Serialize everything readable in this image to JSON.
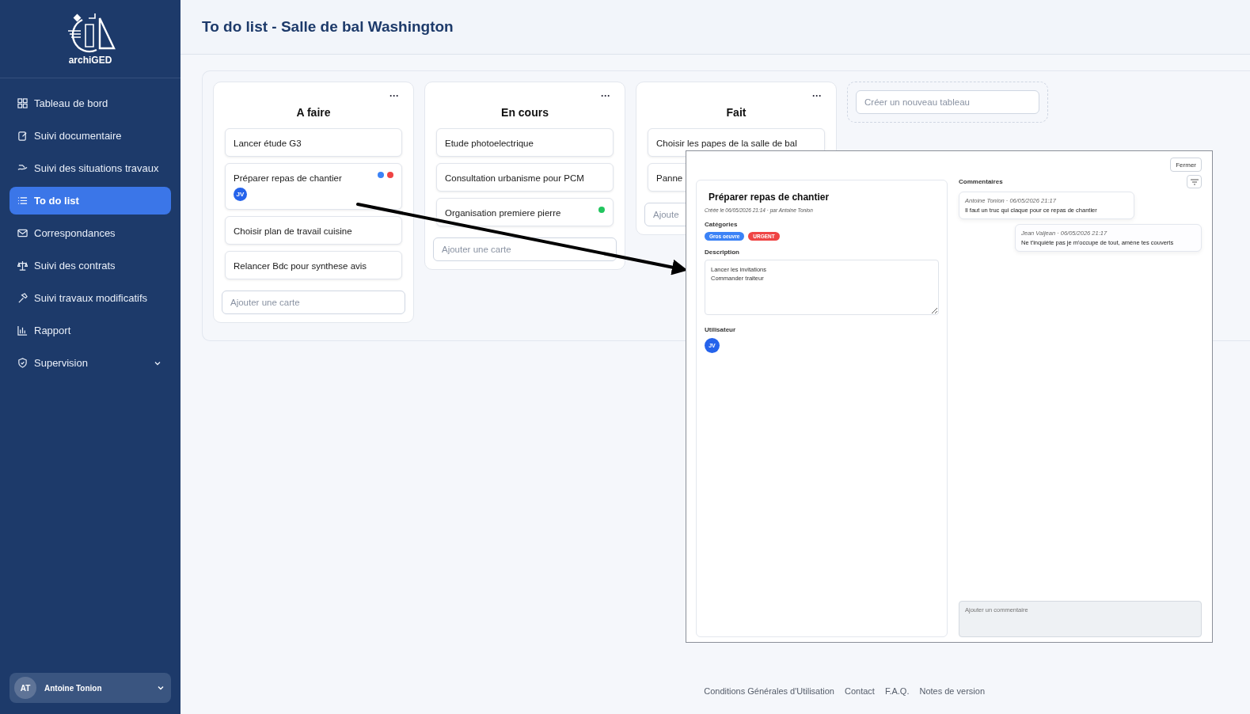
{
  "sidebar": {
    "logo_text": "archiGED",
    "items": [
      {
        "label": "Tableau de bord",
        "kind": "grid",
        "selected": false
      },
      {
        "label": "Suivi documentaire",
        "kind": "doc",
        "selected": false
      },
      {
        "label": "Suivi des situations travaux",
        "kind": "hand",
        "selected": false
      },
      {
        "label": "To do list",
        "kind": "list",
        "selected": true
      },
      {
        "label": "Correspondances",
        "kind": "mail",
        "selected": false
      },
      {
        "label": "Suivi des contrats",
        "kind": "scale",
        "selected": false
      },
      {
        "label": "Suivi travaux modificatifs",
        "kind": "hammer",
        "selected": false
      },
      {
        "label": "Rapport",
        "kind": "chart",
        "selected": false
      },
      {
        "label": "Supervision",
        "kind": "shield",
        "selected": false,
        "expanded": false
      }
    ],
    "user": {
      "initials": "AT",
      "name": "Antoine Tonion"
    }
  },
  "page_title": "To do list - Salle de bal Washington",
  "columns": [
    {
      "title": "A faire",
      "menu": "···",
      "cards": [
        {
          "title": "Lancer étude G3"
        },
        {
          "title": "Préparer repas de chantier",
          "dots": [
            {
              "color": "#3b82f6"
            },
            {
              "color": "#ef4444"
            }
          ],
          "assignee": "JV"
        },
        {
          "title": "Choisir plan de travail cuisine"
        },
        {
          "title": "Relancer Bdc pour synthese avis"
        }
      ],
      "add_placeholder": "Ajouter une carte"
    },
    {
      "title": "En cours",
      "menu": "···",
      "cards": [
        {
          "title": "Etude photoelectrique"
        },
        {
          "title": "Consultation urbanisme pour PCM"
        },
        {
          "title": "Organisation premiere pierre",
          "dots": [
            {
              "color": "#22c55e"
            }
          ]
        }
      ],
      "add_placeholder": "Ajouter une carte"
    },
    {
      "title": "Fait",
      "menu": "···",
      "cards": [
        {
          "title": "Choisir les papes de la salle de bal"
        },
        {
          "title": "Panne"
        }
      ],
      "add_placeholder": "Ajoute"
    }
  ],
  "new_board_placeholder": "Créer un nouveau tableau",
  "detail": {
    "close": "Fermer",
    "title": "Préparer repas de chantier",
    "meta": "Créée le 06/05/2026 21:14 · par Antoine Tonion",
    "categories_label": "Catégories",
    "categories": [
      {
        "label": "Gros oeuvre",
        "color": "#3b82f6"
      },
      {
        "label": "URGENT",
        "color": "#ef4444"
      }
    ],
    "description_label": "Description",
    "description": "Lancer les invitations\nCommander traiteur",
    "user_label": "Utilisateur",
    "user": "JV",
    "comments_label": "Commentaires",
    "comments": [
      {
        "meta": "Antoine Tonion · 06/05/2026 21:17",
        "text": "Il faut un truc qui claque pour ce repas de chantier",
        "mine": false
      },
      {
        "meta": "Jean Valjean · 06/05/2026 21:17",
        "text": "Ne t'inquiète pas je m'occupe de tout, amène tes couverts",
        "mine": true
      }
    ],
    "comment_placeholder": "Ajouter un commentaire"
  },
  "footer": [
    "Conditions Générales d'Utilisation",
    "Contact",
    "F.A.Q.",
    "Notes de version"
  ]
}
